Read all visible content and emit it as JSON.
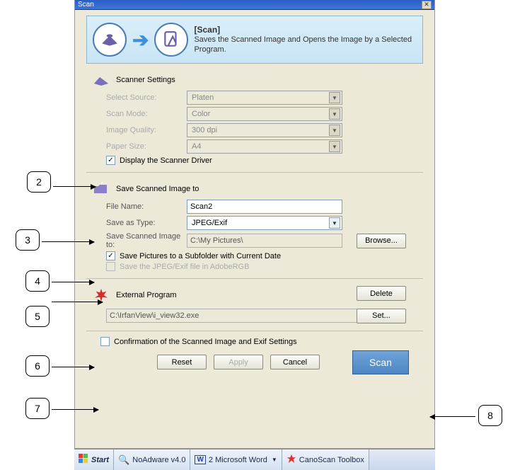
{
  "titlebar": {
    "title": "Scan"
  },
  "banner": {
    "title": "[Scan]",
    "desc": "Saves the Scanned Image and Opens the Image by a Selected Program."
  },
  "scanner": {
    "heading": "Scanner Settings",
    "select_source_lbl": "Select Source:",
    "select_source_val": "Platen",
    "scan_mode_lbl": "Scan Mode:",
    "scan_mode_val": "Color",
    "image_quality_lbl": "Image Quality:",
    "image_quality_val": "300 dpi",
    "paper_size_lbl": "Paper Size:",
    "paper_size_val": "A4",
    "display_driver_label": "Display the Scanner Driver"
  },
  "save": {
    "heading": "Save Scanned Image to",
    "file_name_lbl": "File Name:",
    "file_name_val": "Scan2",
    "save_as_type_lbl": "Save as Type:",
    "save_as_type_val": "JPEG/Exif",
    "save_to_lbl": "Save Scanned Image to:",
    "save_to_val": "C:\\My Pictures\\",
    "browse_btn": "Browse...",
    "subfolder_label": "Save Pictures to a Subfolder with Current Date",
    "adobergb_label": "Save the JPEG/Exif file in AdobeRGB"
  },
  "external": {
    "heading": "External Program",
    "path": "C:\\IrfanView\\i_view32.exe",
    "delete_btn": "Delete",
    "set_btn": "Set..."
  },
  "footer": {
    "confirm_label": "Confirmation of the Scanned Image and Exif Settings",
    "reset": "Reset",
    "apply": "Apply",
    "cancel": "Cancel",
    "scan": "Scan"
  },
  "taskbar": {
    "start": "Start",
    "items": [
      "NoAdware v4.0",
      "2 Microsoft Word",
      "CanoScan Toolbox"
    ]
  },
  "callouts": {
    "c2": "2",
    "c3": "3",
    "c4": "4",
    "c5": "5",
    "c6": "6",
    "c7": "7",
    "c8": "8"
  }
}
